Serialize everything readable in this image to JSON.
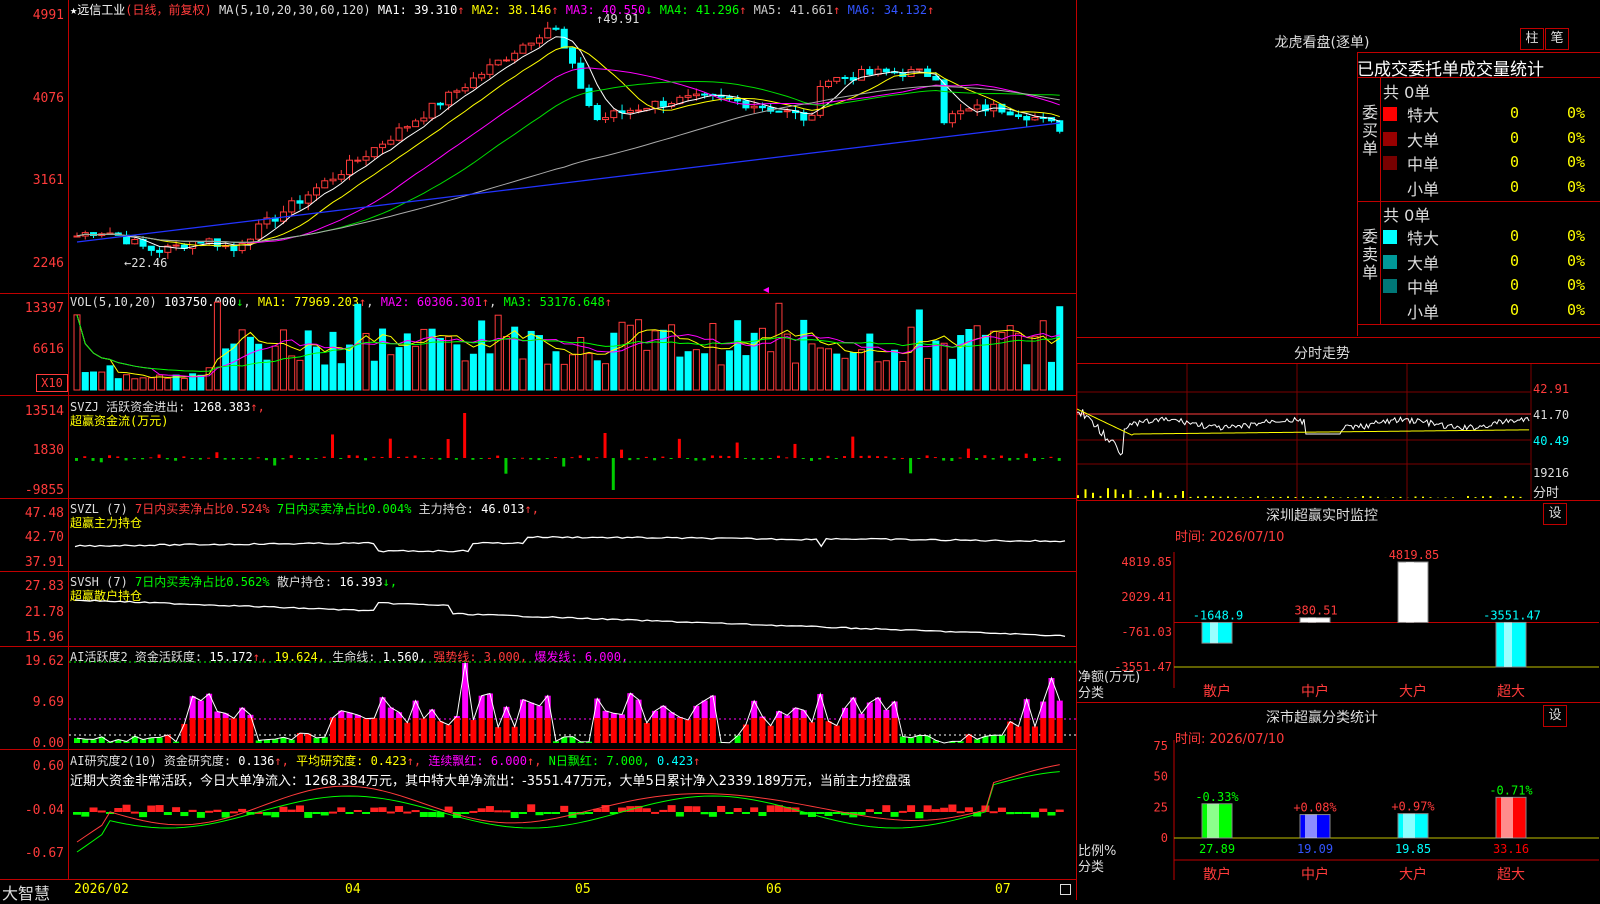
{
  "stock": {
    "name": "远信工业",
    "period": "(日线，前复权)",
    "ma_label": "MA(5,10,20,30,60,120)",
    "ma": [
      {
        "k": "MA1:",
        "v": "39.310",
        "arr": "↑",
        "c": "#ffffff"
      },
      {
        "k": "MA2:",
        "v": "38.146",
        "arr": "↑",
        "c": "#ffff00"
      },
      {
        "k": "MA3:",
        "v": "40.550",
        "arr": "↓",
        "c": "#ff00ff"
      },
      {
        "k": "MA4:",
        "v": "41.296",
        "arr": "↑",
        "c": "#00ff00"
      },
      {
        "k": "MA5:",
        "v": "41.661",
        "arr": "↑",
        "c": "#cccccc"
      },
      {
        "k": "MA6:",
        "v": "34.132",
        "arr": "↑",
        "c": "#3355ff"
      }
    ],
    "high_label": "49.91",
    "low_label": "←22.46"
  },
  "axes": {
    "price": [
      "4991",
      "4076",
      "3161",
      "2246"
    ],
    "vol": [
      "13397",
      "6616",
      "X10"
    ],
    "svzj": [
      "13514",
      "1830",
      "-9855"
    ],
    "svzl": [
      "47.48",
      "42.70",
      "37.91"
    ],
    "svsh": [
      "27.83",
      "21.78",
      "15.96"
    ],
    "ai": [
      "19.62",
      "9.69",
      "0.00"
    ],
    "ai2": [
      "0.60",
      "-0.04",
      "-0.67"
    ],
    "dates": [
      "2026/02",
      "04",
      "05",
      "06",
      "07"
    ]
  },
  "panels": {
    "vol": {
      "label": "VOL(5,10,20)",
      "val": "103750.000",
      "arr": "↓",
      "ma1": "MA1: 77969.203",
      "ma1a": "↑",
      "ma2": "MA2: 60306.301",
      "ma2a": "↑",
      "ma3": "MA3: 53176.648",
      "ma3a": "↑"
    },
    "svzj": {
      "label": "SVZJ",
      "txt": "活跃资金进出:",
      "val": "1268.383",
      "arr": "↑,",
      "sub": "超赢资金流(万元)"
    },
    "svzl": {
      "label": "SVZL (7)",
      "t1": "7日内买卖净占比0.524%",
      "t2": "7日内买卖净占比0.004%",
      "t3": "主力持仓:",
      "val": "46.013",
      "arr": "↑,",
      "sub": "超赢主力持仓"
    },
    "svsh": {
      "label": "SVSH (7)",
      "t1": "7日内买卖净占比0.562%",
      "t2": "散户持仓:",
      "val": "16.393",
      "arr": "↓,",
      "sub": "超赢散户持仓"
    },
    "ai": {
      "label": "AI活跃度2",
      "t1": "资金活跃度:",
      "v1": "15.172",
      "a1": "↑,",
      "v2": "19.624,",
      "t3": "生命线:",
      "v3": "1.560,",
      "t4": "强势线:",
      "v4": "3.000,",
      "t5": "爆发线:",
      "v5": "6.000,"
    },
    "ai2": {
      "label": "AI研究度2(10)",
      "t1": "资金研究度:",
      "v1": "0.136",
      "a1": "↑,",
      "t2": "平均研究度:",
      "v2": "0.423",
      "a2": "↑,",
      "t3": "连续飘红:",
      "v3": "6.000",
      "a3": "↑,",
      "t4": "N日飘红:",
      "v4": "7.000,",
      "v5": "0.423",
      "a5": "↑",
      "summary": "近期大资金非常活跃，今日大单净流入：1268.384万元，其中特大单净流出：-3551.47万元，大单5日累计净入2339.189万元，当前主力控盘强"
    }
  },
  "bottom": {
    "brand": "大智慧"
  },
  "right": {
    "lhkp_title": "龙虎看盘(逐单)",
    "btn_zhu": "柱",
    "btn_bi": "笔",
    "table_title": "已成交委托单成交量统计",
    "buy_label": "委买单",
    "sell_label": "委卖单",
    "buy_total": "共 0单",
    "sell_total": "共 0单",
    "buy_rows": [
      {
        "name": "特大",
        "n": "0",
        "p": "0%",
        "c": "#ff0000"
      },
      {
        "name": "大单",
        "n": "0",
        "p": "0%",
        "c": "#990000"
      },
      {
        "name": "中单",
        "n": "0",
        "p": "0%",
        "c": "#770000"
      },
      {
        "name": "小单",
        "n": "0",
        "p": "0%",
        "c": ""
      }
    ],
    "sell_rows": [
      {
        "name": "特大",
        "n": "0",
        "p": "0%",
        "c": "#00ffff"
      },
      {
        "name": "大单",
        "n": "0",
        "p": "0%",
        "c": "#009999"
      },
      {
        "name": "中单",
        "n": "0",
        "p": "0%",
        "c": "#007777"
      },
      {
        "name": "小单",
        "n": "0",
        "p": "0%",
        "c": ""
      }
    ],
    "fs_title": "分时走势",
    "fs_axis": [
      "42.91",
      "41.70",
      "40.49",
      "19216",
      "分时"
    ],
    "sz_title": "深圳超赢实时监控",
    "sz_btn": "设",
    "sz_time": "时间: 2026/07/10",
    "sz_axis": [
      "4819.85",
      "2029.41",
      "-761.03",
      "-3551.47"
    ],
    "sz_ylabel": "净额(万元)",
    "sz_xlabel": "分类",
    "cat_title": "深市超赢分类统计",
    "cat_btn": "设",
    "cat_time": "时间: 2026/07/10",
    "cat_axis": [
      "75",
      "50",
      "25",
      "0"
    ],
    "cat_ylabel": "比例%",
    "cat_xlabel": "分类"
  },
  "chart_data": [
    {
      "type": "bar",
      "title": "深圳超赢实时监控",
      "ylabel": "净额(万元)",
      "xlabel": "分类",
      "categories": [
        "散户",
        "中户",
        "大户",
        "超大"
      ],
      "values": [
        -1648.9,
        380.51,
        4819.85,
        -3551.47
      ],
      "labels": [
        "-1648.9",
        "380.51",
        "4819.85",
        "-3551.47"
      ],
      "ylim": [
        -3551.47,
        4819.85
      ],
      "colors": [
        "#00ffff",
        "#ffffff",
        "#ffffff",
        "#00ffff"
      ]
    },
    {
      "type": "bar",
      "title": "深市超赢分类统计",
      "ylabel": "比例%",
      "xlabel": "分类",
      "categories": [
        "散户",
        "中户",
        "大户",
        "超大"
      ],
      "values": [
        27.89,
        19.09,
        19.85,
        33.16
      ],
      "labels": [
        "27.89",
        "19.09",
        "19.85",
        "33.16"
      ],
      "changes": [
        "-0.33%",
        "+0.08%",
        "+0.97%",
        "-0.71%"
      ],
      "change_colors": [
        "#00ff00",
        "#ff3b3b",
        "#ff3b3b",
        "#00ff00"
      ],
      "ylim": [
        0,
        75
      ],
      "colors": [
        "#00ff00",
        "#0000ff",
        "#00ffff",
        "#ff0000"
      ]
    }
  ]
}
